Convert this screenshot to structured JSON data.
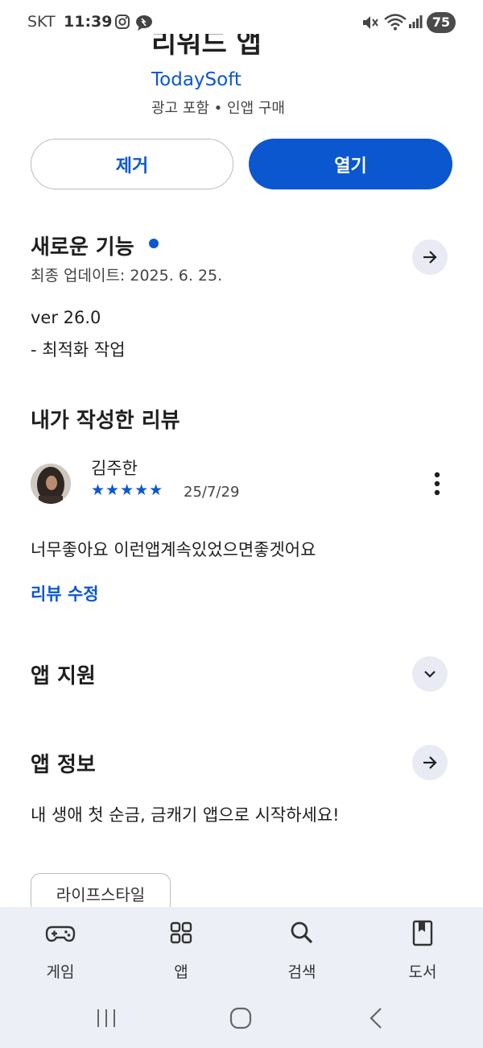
{
  "status_bar": {
    "carrier": "SKT",
    "time": "11:39",
    "battery": "75",
    "icons": [
      "instagram-icon",
      "chat-icon",
      "mute-icon",
      "wifi-icon",
      "signal-icon"
    ]
  },
  "header": {
    "app_name": "리워드 앱",
    "developer": "TodaySoft",
    "meta": "광고 포함 • 인앱 구매"
  },
  "actions": {
    "uninstall_label": "제거",
    "open_label": "열기"
  },
  "whats_new": {
    "title": "새로운 기능",
    "last_updated": "최종 업데이트: 2025. 6. 25.",
    "version": "ver 26.0",
    "changes": "- 최적화 작업"
  },
  "my_review": {
    "title": "내가 작성한 리뷰",
    "reviewer_name": "김주한",
    "stars": "★★★★★",
    "rating": 5,
    "date": "25/7/29",
    "text": "너무좋아요 이런앱계속있었으면좋겟어요",
    "edit_label": "리뷰 수정"
  },
  "app_support": {
    "title": "앱 지원"
  },
  "app_info": {
    "title": "앱 정보",
    "description": "내 생애 첫 순금, 금캐기 앱으로 시작하세요!",
    "category_chip": "라이프스타일"
  },
  "bottom_nav": {
    "items": [
      {
        "label": "게임",
        "icon": "gamepad-icon"
      },
      {
        "label": "앱",
        "icon": "apps-grid-icon"
      },
      {
        "label": "검색",
        "icon": "search-icon"
      },
      {
        "label": "도서",
        "icon": "book-icon"
      }
    ]
  },
  "colors": {
    "accent": "#0b57d0",
    "nav_background": "#ecf0f6",
    "chip_border": "#b8bcc2"
  }
}
